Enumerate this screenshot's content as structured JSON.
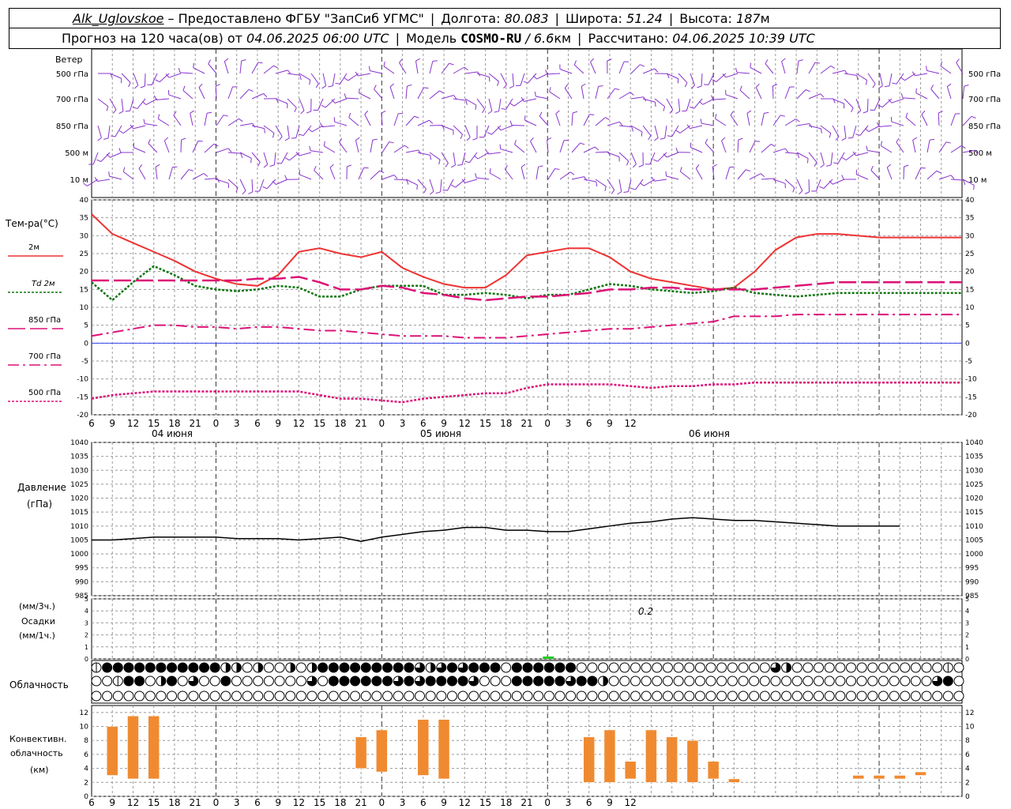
{
  "header": {
    "station": "Alk_Uglovskoe",
    "provider": " – Предоставлено ФГБУ \"ЗапСиб УГМС\"",
    "lon_label": "Долгота: ",
    "lon": "80.083",
    "lat_label": "Широта: ",
    "lat": "51.24",
    "alt_label": "Высота: ",
    "alt": "187",
    "alt_unit": "м",
    "forecast_label": "Прогноз на 120 часа(ов) от ",
    "forecast_time": "04.06.2025 06:00 UTC",
    "model_label": "Модель ",
    "model": "COSMO-RU",
    "model_res": " / 6.6",
    "model_res_unit": "км",
    "calc_label": "Рассчитано: ",
    "calc_time": "04.06.2025 10:39 UTC"
  },
  "colors": {
    "t2m": "#ee3333",
    "td2m": "#117711",
    "levels": "#dd1177",
    "wind": "#8833cc",
    "zero_line": "#3344ee",
    "precip": "#22cc22",
    "conv": "#f08a30",
    "grid": "#999999"
  },
  "wind_panel": {
    "title": "Ветер",
    "levels": [
      "500 гПа",
      "700 гПа",
      "850 гПа",
      "500 м",
      "10 м"
    ]
  },
  "temp_legend": {
    "title": "Тем-ра(°C)",
    "items": [
      "2м",
      "Td 2м",
      "850 гПа",
      "700 гПа",
      "500 гПа"
    ]
  },
  "pressure_labels": [
    "Давление",
    "(гПа)"
  ],
  "precip_labels": [
    "(мм/3ч.)",
    "Осадки",
    "(мм/1ч.)"
  ],
  "precip_annotation": "0.2",
  "cloud_label": "Облачность",
  "conv_labels": [
    "Конвективн.",
    "облачность",
    "(км)"
  ],
  "x_hour_labels": [
    "6",
    "9",
    "12",
    "15",
    "18",
    "21",
    "0",
    "3",
    "6",
    "9",
    "12",
    "15",
    "18",
    "21",
    "0",
    "3",
    "6",
    "9",
    "12",
    "15",
    "18",
    "21",
    "0",
    "3",
    "6",
    "9",
    "12"
  ],
  "day_labels": [
    "04 июня",
    "05 июня",
    "06 июня"
  ],
  "chart_data": [
    {
      "type": "line",
      "panel": "temperature",
      "x_hours": [
        0,
        3,
        6,
        9,
        12,
        15,
        18,
        21,
        24,
        27,
        30,
        33,
        36,
        39,
        42,
        45,
        48,
        51,
        54,
        57,
        60,
        63,
        66,
        69,
        72,
        75,
        78,
        81,
        84,
        87,
        90,
        93,
        96,
        99,
        102,
        105,
        108,
        111,
        114,
        117,
        120,
        123,
        126
      ],
      "ylim": [
        -20,
        40
      ],
      "yticks": [
        -20,
        -15,
        -10,
        -5,
        0,
        5,
        10,
        15,
        20,
        25,
        30,
        35,
        40
      ],
      "series": [
        {
          "name": "2м",
          "values": [
            36,
            30.5,
            28,
            25.5,
            23,
            20,
            18,
            16.5,
            16,
            19,
            25.5,
            26.5,
            25,
            24,
            25.5,
            21,
            18.5,
            16.5,
            15.5,
            15.5,
            19,
            24.5,
            25.5,
            26.5,
            26.5,
            24,
            20,
            18,
            17,
            16,
            15,
            15.5,
            20,
            26,
            29.5,
            30.5,
            30.5,
            30,
            29.5,
            29.5,
            29.5,
            29.5,
            29.5
          ]
        },
        {
          "name": "Td 2м",
          "values": [
            17,
            12,
            17,
            21.5,
            19,
            16,
            15,
            14.5,
            15,
            16,
            15.5,
            13,
            13,
            15,
            16,
            16,
            16,
            13.5,
            13.5,
            14,
            13.5,
            12.5,
            13.5,
            13.5,
            15,
            16.5,
            16,
            15,
            14.5,
            14,
            14.5,
            15.5,
            14,
            13.5,
            13,
            13.5,
            14,
            14,
            14,
            14,
            14,
            14,
            14
          ]
        },
        {
          "name": "850 гПа",
          "values": [
            17.5,
            17.5,
            17.5,
            17.5,
            17.5,
            17.5,
            17.5,
            17.5,
            18,
            18,
            18.5,
            17,
            15,
            15,
            16,
            15.5,
            14,
            13.5,
            12.5,
            12,
            12.5,
            13,
            13,
            13.5,
            14,
            15,
            15,
            15.5,
            15.5,
            15,
            15,
            15,
            15,
            15.5,
            16,
            16.5,
            17,
            17,
            17,
            17,
            17,
            17,
            17
          ]
        },
        {
          "name": "700 гПа",
          "values": [
            2,
            3,
            4,
            5,
            5,
            4.5,
            4.5,
            4,
            4.5,
            4.5,
            4,
            3.5,
            3.5,
            3,
            2.5,
            2,
            2,
            2,
            1.5,
            1.5,
            1.5,
            2,
            2.5,
            3,
            3.5,
            4,
            4,
            4.5,
            5,
            5.5,
            6,
            7.5,
            7.5,
            7.5,
            8,
            8,
            8,
            8,
            8,
            8,
            8,
            8,
            8
          ]
        },
        {
          "name": "500 гПа",
          "values": [
            -15.5,
            -14.5,
            -14,
            -13.5,
            -13.5,
            -13.5,
            -13.5,
            -13.5,
            -13.5,
            -13.5,
            -13.5,
            -14.5,
            -15.5,
            -15.5,
            -16,
            -16.5,
            -15.5,
            -15,
            -14.5,
            -14,
            -14,
            -12.5,
            -11.5,
            -11.5,
            -11.5,
            -11.5,
            -12,
            -12.5,
            -12,
            -12,
            -11.5,
            -11.5,
            -11,
            -11,
            -11,
            -11,
            -11,
            -11,
            -11,
            -11,
            -11,
            -11,
            -11
          ]
        }
      ]
    },
    {
      "type": "line",
      "panel": "pressure",
      "x_hours": [
        0,
        3,
        6,
        9,
        12,
        15,
        18,
        21,
        24,
        27,
        30,
        33,
        36,
        39,
        42,
        45,
        48,
        51,
        54,
        57,
        60,
        63,
        66,
        69,
        72,
        75,
        78,
        81,
        84,
        87,
        90,
        93,
        96,
        99,
        102,
        105,
        108,
        111,
        114,
        117
      ],
      "ylim": [
        985,
        1040
      ],
      "yticks": [
        985,
        990,
        995,
        1000,
        1005,
        1010,
        1015,
        1020,
        1025,
        1030,
        1035,
        1040
      ],
      "series": [
        {
          "name": "Давление",
          "values": [
            1005,
            1005,
            1005.5,
            1006,
            1006,
            1006,
            1006,
            1005.5,
            1005.5,
            1005.5,
            1005,
            1005.5,
            1006,
            1004.5,
            1006,
            1007,
            1008,
            1008.5,
            1009.5,
            1009.5,
            1008.5,
            1008.5,
            1008,
            1008,
            1009,
            1010,
            1011,
            1011.5,
            1012.5,
            1013,
            1012.5,
            1012,
            1012,
            1011.5,
            1011,
            1010.5,
            1010,
            1010,
            1010,
            1010
          ]
        }
      ]
    },
    {
      "type": "bar",
      "panel": "precipitation",
      "ylim": [
        0,
        5
      ],
      "yticks": [
        0,
        1,
        2,
        3,
        4,
        5
      ],
      "x_hours": [
        66
      ],
      "values": [
        0.2
      ]
    },
    {
      "type": "bar",
      "panel": "convective_cloud",
      "ylim": [
        0,
        13
      ],
      "yticks": [
        0,
        2,
        4,
        6,
        8,
        10,
        12
      ],
      "bars": [
        {
          "x_hour": 1,
          "bottom": 3,
          "top": 10
        },
        {
          "x_hour": 2,
          "bottom": 2.5,
          "top": 11.5
        },
        {
          "x_hour": 3,
          "bottom": 2.5,
          "top": 11.5
        },
        {
          "x_hour": 13,
          "bottom": 4,
          "top": 8.5
        },
        {
          "x_hour": 14,
          "bottom": 3.5,
          "top": 9.5
        },
        {
          "x_hour": 16,
          "bottom": 3,
          "top": 11
        },
        {
          "x_hour": 17,
          "bottom": 2.5,
          "top": 11
        },
        {
          "x_hour": 24,
          "bottom": 2,
          "top": 8.5
        },
        {
          "x_hour": 25,
          "bottom": 2,
          "top": 9.5
        },
        {
          "x_hour": 26,
          "bottom": 2.5,
          "top": 5
        },
        {
          "x_hour": 27,
          "bottom": 2,
          "top": 9.5
        },
        {
          "x_hour": 28,
          "bottom": 2,
          "top": 8.5
        },
        {
          "x_hour": 29,
          "bottom": 2,
          "top": 8
        },
        {
          "x_hour": 30,
          "bottom": 2.5,
          "top": 5
        },
        {
          "x_hour": 31,
          "bottom": 2,
          "top": 2.5
        },
        {
          "x_hour": 37,
          "bottom": 2.5,
          "top": 3
        },
        {
          "x_hour": 38,
          "bottom": 2.5,
          "top": 3
        },
        {
          "x_hour": 39,
          "bottom": 2.5,
          "top": 3
        },
        {
          "x_hour": 40,
          "bottom": 3,
          "top": 3.5
        }
      ]
    },
    {
      "type": "table",
      "panel": "cloudiness",
      "rows": [
        [
          1,
          4,
          4,
          4,
          4,
          4,
          4,
          4,
          4,
          4,
          4,
          4,
          2,
          2,
          0,
          2,
          0,
          0,
          2,
          0,
          2,
          4,
          4,
          4,
          4,
          4,
          4,
          4,
          4,
          4,
          3,
          2,
          3,
          4,
          3,
          4,
          4,
          4,
          0,
          4,
          4,
          4,
          4,
          4,
          4,
          0,
          0,
          0,
          0,
          0,
          0,
          0,
          0,
          0,
          0,
          0,
          0,
          0,
          0,
          0,
          0,
          0,
          0,
          3,
          2,
          0,
          0,
          0,
          0,
          0,
          0,
          0,
          0,
          0,
          0,
          0,
          0,
          0,
          0,
          1,
          0,
          3
        ],
        [
          0,
          0,
          1,
          4,
          4,
          0,
          2,
          4,
          0,
          3,
          0,
          0,
          4,
          0,
          0,
          0,
          0,
          0,
          0,
          0,
          3,
          0,
          4,
          4,
          4,
          4,
          4,
          4,
          3,
          4,
          3,
          4,
          4,
          4,
          4,
          3,
          0,
          0,
          0,
          4,
          4,
          4,
          4,
          4,
          3,
          4,
          4,
          2,
          0,
          0,
          0,
          0,
          0,
          0,
          0,
          0,
          0,
          0,
          0,
          0,
          0,
          0,
          0,
          0,
          0,
          0,
          0,
          0,
          0,
          0,
          0,
          0,
          0,
          0,
          0,
          0,
          0,
          0,
          3,
          4,
          0,
          0
        ],
        [
          0,
          0,
          0,
          0,
          0,
          0,
          0,
          0,
          0,
          0,
          0,
          0,
          0,
          0,
          0,
          0,
          0,
          0,
          0,
          0,
          0,
          0,
          0,
          0,
          0,
          0,
          0,
          0,
          0,
          0,
          0,
          0,
          0,
          0,
          0,
          0,
          0,
          0,
          0,
          0,
          0,
          0,
          0,
          0,
          0,
          0,
          0,
          0,
          0,
          0,
          0,
          0,
          0,
          0,
          0,
          0,
          0,
          0,
          0,
          0,
          0,
          0,
          0,
          0,
          0,
          0,
          0,
          0,
          0,
          0,
          0,
          0,
          0,
          0,
          0,
          0,
          0,
          0,
          0,
          0,
          0,
          0
        ]
      ]
    }
  ]
}
